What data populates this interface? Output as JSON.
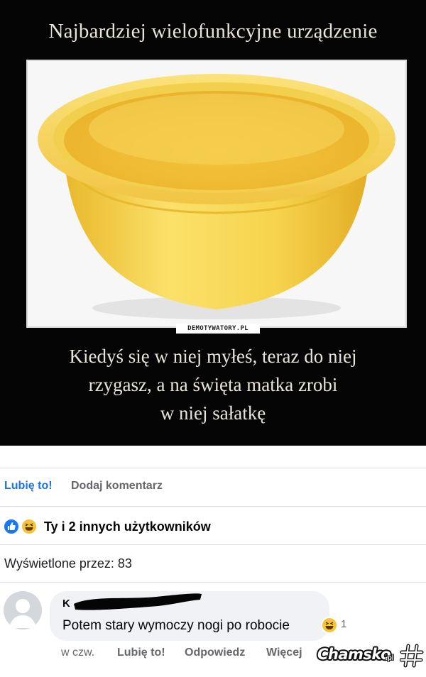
{
  "meme": {
    "title": "Najbardziej wielofunkcyjne urządzenie",
    "watermark": "DEMOTYWATORY.PL",
    "caption_lines": [
      "Kiedyś się w niej myłeś, teraz do niej",
      "rzygasz, a na święta matka zrobi",
      "w niej sałatkę"
    ],
    "image_icon": "yellow-basin"
  },
  "post_actions": {
    "like_label": "Lubię to!",
    "comment_label": "Dodaj komentarz",
    "like_color": "#1b74e4"
  },
  "reactions": {
    "icons": [
      "like-icon",
      "haha-icon"
    ],
    "summary": "Ty i 2 innych użytkowników"
  },
  "views": {
    "label": "Wyświetlone przez: 83"
  },
  "comment": {
    "author": "K",
    "author_redacted": true,
    "text": "Potem stary wymoczy nogi po robocie",
    "reaction_icon": "haha-icon",
    "reaction_count": "1",
    "time": "w czw.",
    "like_label": "Lubię to!",
    "reply_label": "Odpowiedz",
    "more_label": "Więcej"
  },
  "site_watermark": {
    "name": "Chamsko",
    "suffix": ".pl"
  },
  "colors": {
    "meme_bg": "#050505",
    "basin_yellow": "#f6d64a",
    "facebook_blue": "#1877f2",
    "haha_yellow": "#f7c33a"
  }
}
